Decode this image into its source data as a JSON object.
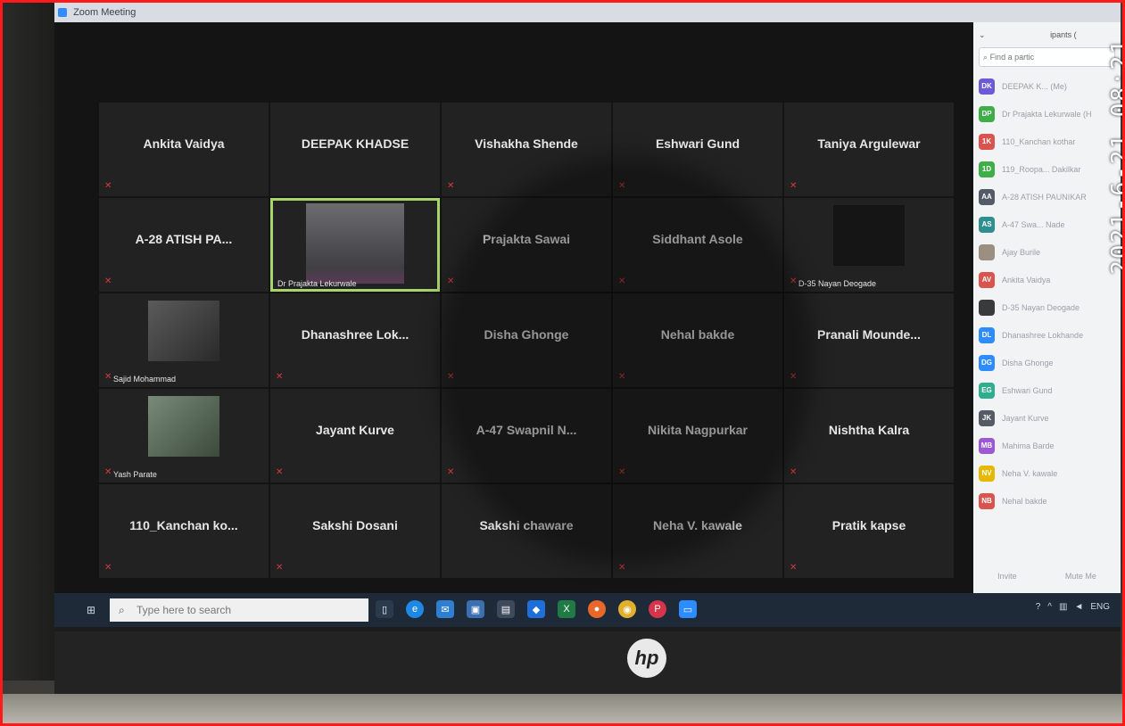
{
  "window": {
    "title": "Zoom Meeting"
  },
  "gallery": {
    "tiles": [
      {
        "name": "Ankita Vaidya"
      },
      {
        "name": "DEEPAK KHADSE"
      },
      {
        "name": "Vishakha Shende"
      },
      {
        "name": "Eshwari Gund"
      },
      {
        "name": "Taniya Argulewar"
      },
      {
        "name": "A-28 ATISH PA..."
      },
      {
        "name": "",
        "label": "Dr Prajakta Lekurwale"
      },
      {
        "name": "Prajakta Sawai"
      },
      {
        "name": "Siddhant Asole"
      },
      {
        "name": "",
        "label": "D-35 Nayan Deogade"
      },
      {
        "name": "",
        "label": "Sajid Mohammad"
      },
      {
        "name": "Dhanashree Lok..."
      },
      {
        "name": "Disha Ghonge"
      },
      {
        "name": "Nehal bakde"
      },
      {
        "name": "Pranali Mounde..."
      },
      {
        "name": "",
        "label": "Yash Parate"
      },
      {
        "name": "Jayant Kurve"
      },
      {
        "name": "A-47 Swapnil N..."
      },
      {
        "name": "Nikita Nagpurkar"
      },
      {
        "name": "Nishtha Kalra"
      },
      {
        "name": "110_Kanchan ko..."
      },
      {
        "name": "Sakshi Dosani"
      },
      {
        "name": "Sakshi chaware"
      },
      {
        "name": "Neha V. kawale"
      },
      {
        "name": "Pratik kapse"
      }
    ]
  },
  "participants_panel": {
    "header": "ipants (",
    "search_placeholder": "Find a partic",
    "items": [
      {
        "initials": "DK",
        "name": "DEEPAK K... (Me)",
        "color": "#6b5bd6"
      },
      {
        "initials": "DP",
        "name": "Dr Prajakta Lekurwale (H",
        "color": "#3fae49"
      },
      {
        "initials": "1K",
        "name": "110_Kanchan kothar",
        "color": "#d9534f"
      },
      {
        "initials": "1D",
        "name": "119_Roopa... Dakilkar",
        "color": "#3fae49"
      },
      {
        "initials": "AA",
        "name": "A-28 ATISH PAUNIKAR",
        "color": "#555b66"
      },
      {
        "initials": "AS",
        "name": "A-47 Swa... Nade",
        "color": "#2f8f8f"
      },
      {
        "initials": "",
        "name": "Ajay Burile",
        "color": "#9a8f80"
      },
      {
        "initials": "AV",
        "name": "Ankita Vaidya",
        "color": "#d9534f"
      },
      {
        "initials": "",
        "name": "D-35 Nayan Deogade",
        "color": "#3a3a3a"
      },
      {
        "initials": "DL",
        "name": "Dhanashree Lokhande",
        "color": "#2d8cff"
      },
      {
        "initials": "DG",
        "name": "Disha Ghonge",
        "color": "#2d8cff"
      },
      {
        "initials": "EG",
        "name": "Eshwari Gund",
        "color": "#2fae8f"
      },
      {
        "initials": "JK",
        "name": "Jayant Kurve",
        "color": "#555b66"
      },
      {
        "initials": "MB",
        "name": "Mahima Barde",
        "color": "#9b59d6"
      },
      {
        "initials": "NV",
        "name": "Neha V. kawale",
        "color": "#e6b800"
      },
      {
        "initials": "NB",
        "name": "Nehal bakde",
        "color": "#d9534f"
      }
    ],
    "invite_label": "Invite",
    "mute_me_label": "Mute Me"
  },
  "timestamp": "2021-6-21 08:21",
  "taskbar": {
    "search_placeholder": "Type here to search",
    "tray_lang": "ENG"
  },
  "laptop": {
    "brand": "hp"
  }
}
